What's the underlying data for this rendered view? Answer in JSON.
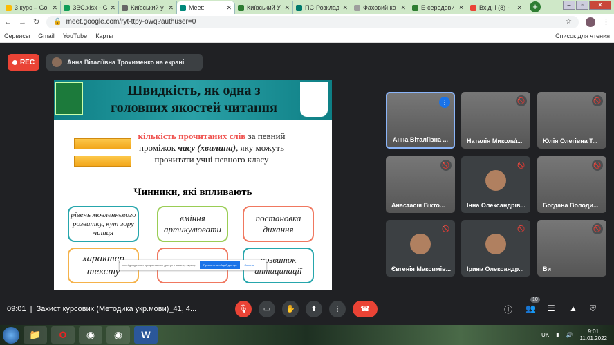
{
  "browser": {
    "tabs": [
      {
        "label": "3 курс – Go",
        "color": "#fbbc04"
      },
      {
        "label": "ЗВС.xlsx - G",
        "color": "#0f9d58"
      },
      {
        "label": "Київський у",
        "color": "#666"
      },
      {
        "label": "Meet: ",
        "color": "#00897b",
        "active": true
      },
      {
        "label": "Київський У",
        "color": "#2e7d32"
      },
      {
        "label": "ПС-Розклад",
        "color": "#00796b"
      },
      {
        "label": "Фаховий ко",
        "color": "#9e9e9e"
      },
      {
        "label": "Е-середови",
        "color": "#2e7d32"
      },
      {
        "label": "Вхідні (8) - ",
        "color": "#ea4335"
      }
    ],
    "new_tab": "+",
    "url": "meet.google.com/ryt-ttpy-owq?authuser=0",
    "bookmarks": [
      "Сервисы",
      "Gmail",
      "YouTube",
      "Карты"
    ],
    "reading_list": "Список для чтения"
  },
  "meet": {
    "rec": "REC",
    "presenting": "Анна Віталіївна Трохименко на екрані",
    "slide": {
      "title": "Швидкість, як одна з головних якостей читання",
      "def_red": "кількість прочитаних слів",
      "def_1": " за певний проміжок ",
      "def_bold": "часу (хвилина)",
      "def_2": ", яку можуть прочитати учні певного класу",
      "factors_heading": "Чинники, які впливають",
      "factors": [
        "рівень мовленнєвого розвитку, кут зору читця",
        "вміння артикулювати",
        "постановка дихання",
        "характер тексту",
        "",
        "розвиток антиципації"
      ]
    },
    "share_bar": {
      "text": "meet.google.com предоставляет доступ к вашему экрану.",
      "stop": "Прекратить общий доступ",
      "hide": "Скрыть"
    },
    "participants": [
      "Анна Віталіївна ...",
      "Наталія Миколаї...",
      "Юлія Олегівна Т...",
      "Анастасія Вікто...",
      "Інна Олександрів...",
      "Богдана Володи...",
      "Євгенія Максимів...",
      "Ірина Олександр...",
      "Ви"
    ],
    "time": "09:01",
    "meeting_name": "Захист курсових (Методика укр.мови)_41, 4...",
    "people_count": "10"
  },
  "taskbar": {
    "lang": "UK",
    "time": "9:01",
    "date": "11.01.2022"
  }
}
